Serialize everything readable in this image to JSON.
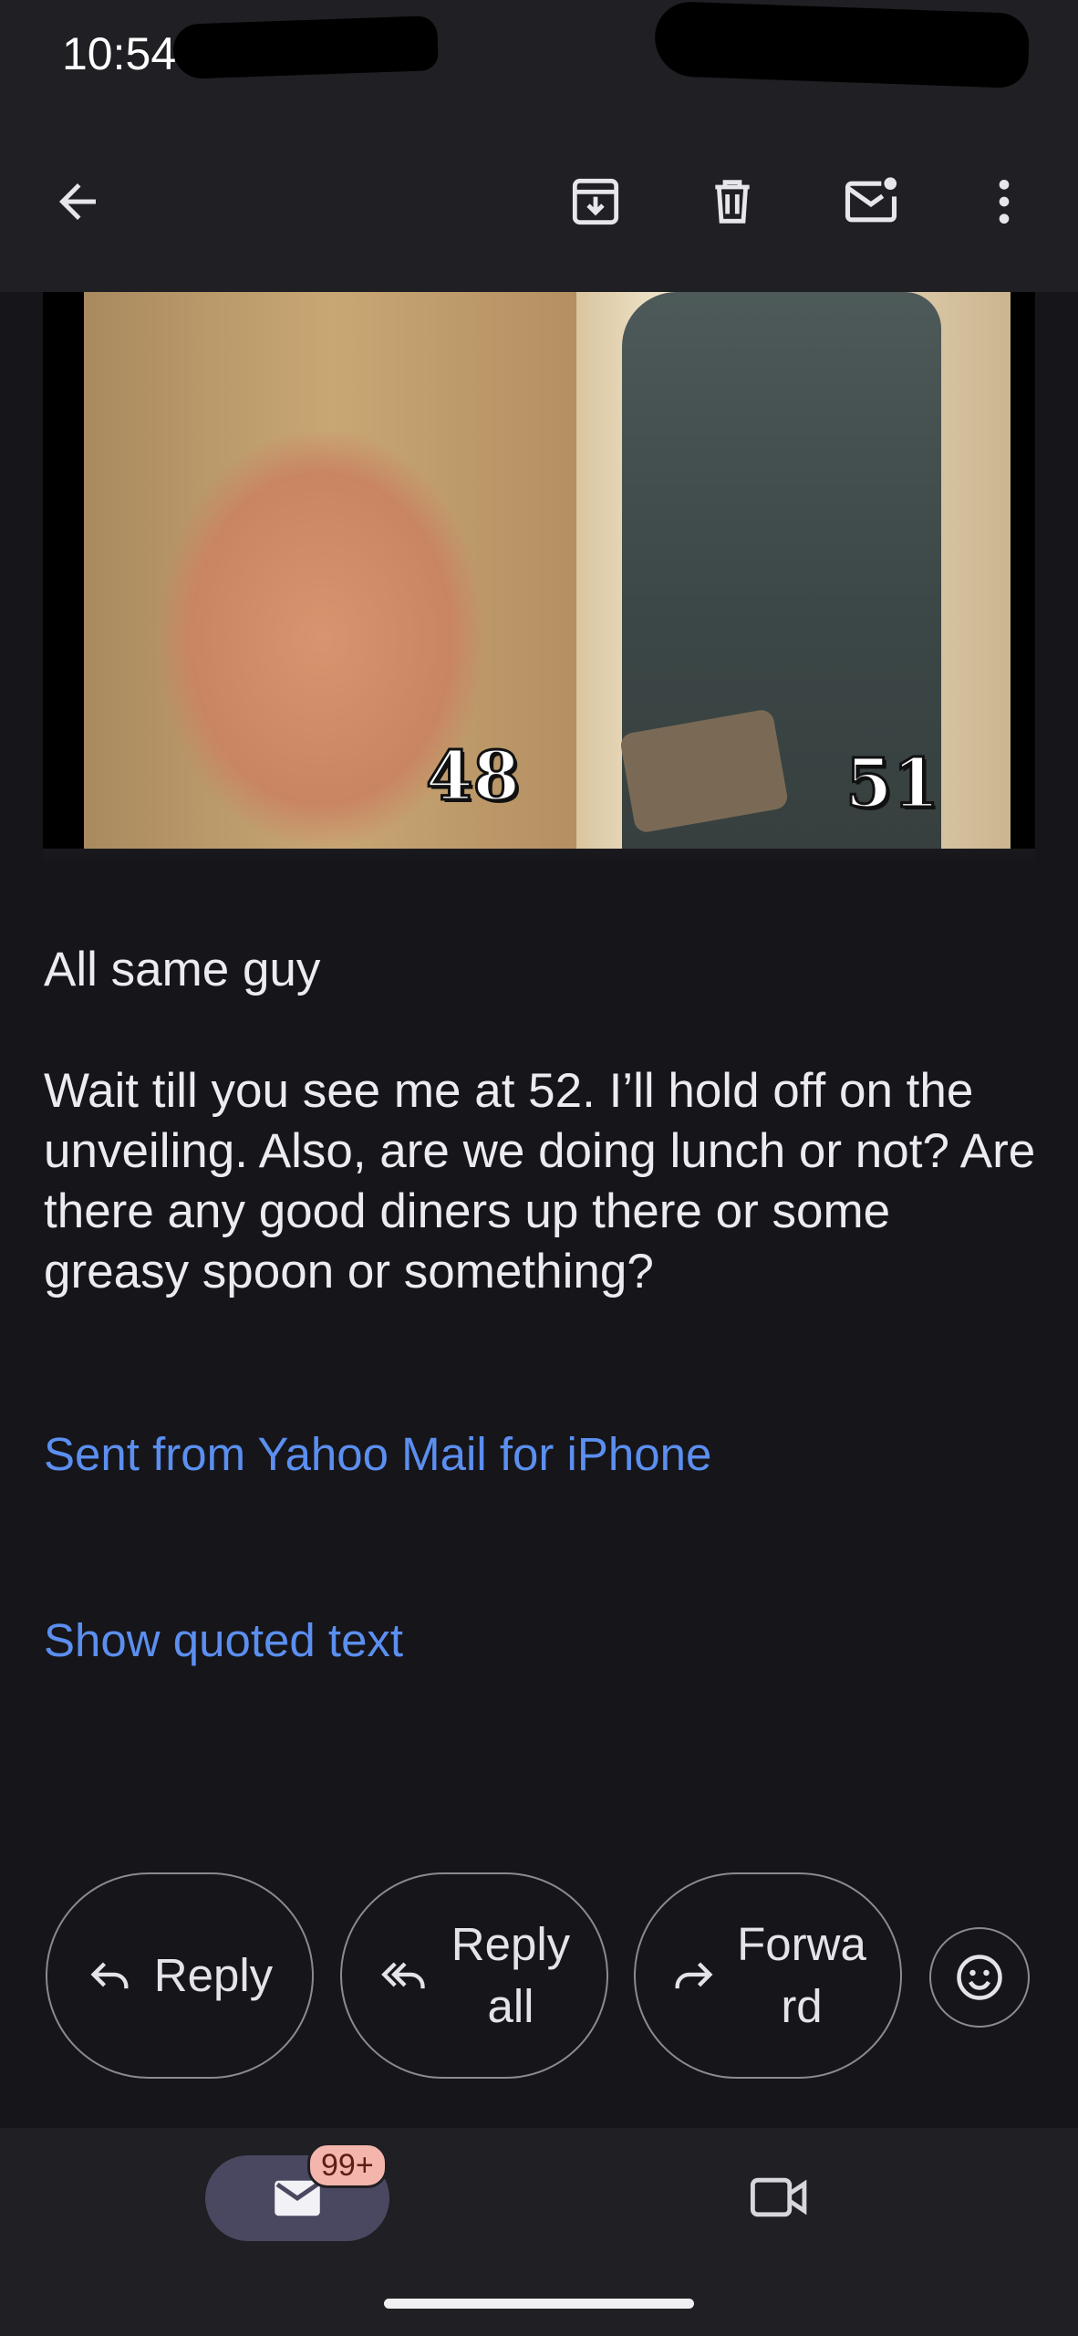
{
  "status_bar": {
    "time": "10:54"
  },
  "toolbar": {
    "back": "arrow-back-icon",
    "archive": "archive-icon",
    "delete": "trash-icon",
    "mark_unread": "mark-unread-icon",
    "more": "more-vert-icon"
  },
  "image": {
    "left_label": "48",
    "right_label": "51"
  },
  "message": {
    "line1": "All same guy",
    "paragraph": "Wait till you see me at 52. I’ll hold off on the unveiling. Also, are we doing lunch or not? Are there any good diners up there or some greasy spoon or something?",
    "signature_link": "Sent from Yahoo Mail for iPhone",
    "show_quoted": "Show quoted text"
  },
  "actions": {
    "reply": "Reply",
    "reply_all_line1": "Reply",
    "reply_all_line2": "all",
    "forward_line1": "Forwa",
    "forward_line2": "rd",
    "emoji": "emoji-reaction-icon"
  },
  "bottom_nav": {
    "mail_badge": "99+",
    "mail": "mail-icon",
    "meet": "video-icon"
  },
  "colors": {
    "background": "#16151a",
    "bar": "#1f1f24",
    "link": "#5b8ff0",
    "badge": "#f4b6ac",
    "active_tab": "#4a4860"
  }
}
